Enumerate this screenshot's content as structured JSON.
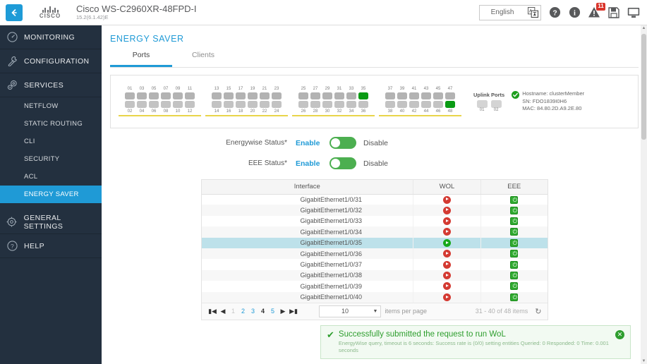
{
  "header": {
    "back_icon": "back-arrow-icon",
    "brand": "CISCO",
    "device_name": "Cisco WS-C2960XR-48FPD-I",
    "device_version": "15.2(6.1.42)E",
    "language": "English",
    "translate_icon": "translate-icon",
    "help_icon": "help-icon",
    "info_icon": "info-icon",
    "alert_icon": "alert-triangle-icon",
    "alert_count": "11",
    "save_icon": "save-icon",
    "console_icon": "monitor-icon"
  },
  "sidebar": {
    "items": [
      {
        "label": "MONITORING",
        "icon": "gauge-icon"
      },
      {
        "label": "CONFIGURATION",
        "icon": "wrench-icon"
      },
      {
        "label": "SERVICES",
        "icon": "services-icon"
      }
    ],
    "sub_items": [
      {
        "label": "NETFLOW",
        "active": false
      },
      {
        "label": "STATIC ROUTING",
        "active": false
      },
      {
        "label": "CLI",
        "active": false
      },
      {
        "label": "SECURITY",
        "active": false
      },
      {
        "label": "ACL",
        "active": false
      },
      {
        "label": "ENERGY SAVER",
        "active": true
      }
    ],
    "footer_items": [
      {
        "label": "GENERAL SETTINGS",
        "icon": "gear-icon"
      },
      {
        "label": "HELP",
        "icon": "question-circle-icon"
      }
    ]
  },
  "main": {
    "page_title": "ENERGY SAVER",
    "tabs": [
      {
        "label": "Ports",
        "active": true
      },
      {
        "label": "Clients",
        "active": false
      }
    ]
  },
  "ports": {
    "groups": [
      {
        "top": [
          "01",
          "03",
          "05",
          "07",
          "09",
          "11"
        ],
        "bottom": [
          "02",
          "04",
          "06",
          "08",
          "10",
          "12"
        ]
      },
      {
        "top": [
          "13",
          "15",
          "17",
          "19",
          "21",
          "23"
        ],
        "bottom": [
          "14",
          "16",
          "18",
          "20",
          "22",
          "24"
        ]
      },
      {
        "top": [
          "25",
          "27",
          "29",
          "31",
          "33",
          "35"
        ],
        "bottom": [
          "26",
          "28",
          "30",
          "32",
          "34",
          "36"
        ]
      },
      {
        "top": [
          "37",
          "39",
          "41",
          "43",
          "45",
          "47"
        ],
        "bottom": [
          "38",
          "40",
          "42",
          "44",
          "46",
          "48"
        ]
      }
    ],
    "active_ports": [
      "35",
      "48"
    ],
    "uplink_label": "Uplink Ports",
    "uplink_ports": [
      "01",
      "02"
    ],
    "status_icon": "status-ok-icon",
    "hostname": "Hostname: clusterMember",
    "serial": "SN: FDO1839I0H6",
    "mac": "MAC: 84.80.2D.A9.2E.80"
  },
  "settings": {
    "energywise": {
      "label": "Energywise Status",
      "required_mark": "*",
      "enable_label": "Enable",
      "disable_label": "Disable",
      "value": "Enable"
    },
    "eee": {
      "label": "EEE Status",
      "required_mark": "*",
      "enable_label": "Enable",
      "disable_label": "Disable",
      "value": "Enable"
    }
  },
  "table": {
    "columns": [
      "Interface",
      "WOL",
      "EEE"
    ],
    "rows": [
      {
        "interface": "GigabitEthernet1/0/31",
        "wol": "stopped",
        "eee": "on",
        "selected": false
      },
      {
        "interface": "GigabitEthernet1/0/32",
        "wol": "stopped",
        "eee": "on",
        "selected": false
      },
      {
        "interface": "GigabitEthernet1/0/33",
        "wol": "stopped",
        "eee": "on",
        "selected": false
      },
      {
        "interface": "GigabitEthernet1/0/34",
        "wol": "stopped",
        "eee": "on",
        "selected": false
      },
      {
        "interface": "GigabitEthernet1/0/35",
        "wol": "running",
        "eee": "on",
        "selected": true
      },
      {
        "interface": "GigabitEthernet1/0/36",
        "wol": "stopped",
        "eee": "on",
        "selected": false
      },
      {
        "interface": "GigabitEthernet1/0/37",
        "wol": "stopped",
        "eee": "on",
        "selected": false
      },
      {
        "interface": "GigabitEthernet1/0/38",
        "wol": "stopped",
        "eee": "on",
        "selected": false
      },
      {
        "interface": "GigabitEthernet1/0/39",
        "wol": "stopped",
        "eee": "on",
        "selected": false
      },
      {
        "interface": "GigabitEthernet1/0/40",
        "wol": "stopped",
        "eee": "on",
        "selected": false
      }
    ]
  },
  "pager": {
    "first_icon": "first-page-icon",
    "prev_icon": "prev-page-icon",
    "pages": [
      {
        "label": "1",
        "state": "disabled"
      },
      {
        "label": "2",
        "state": "link"
      },
      {
        "label": "3",
        "state": "link"
      },
      {
        "label": "4",
        "state": "current"
      },
      {
        "label": "5",
        "state": "link"
      }
    ],
    "next_icon": "next-page-icon",
    "last_icon": "last-page-icon",
    "items_per_page": "10",
    "items_per_page_label": "items per page",
    "range": "31 - 40 of 48 items",
    "refresh_icon": "refresh-icon"
  },
  "toast": {
    "check_icon": "check-icon",
    "title": "Successfully submitted the request to run WoL",
    "detail": "EnergyWise query, timeout is 6 seconds: Success rate is (0/0) setting entities Queried: 0 Responded: 0 Time: 0.001 seconds",
    "close_icon": "close-icon"
  },
  "colors": {
    "accent": "#1f9ad6",
    "sidebar_bg": "#23303f",
    "port_active": "#0a9b14",
    "toggle_on": "#4caf50",
    "alert": "#d9342b",
    "success": "#2e9e2e"
  }
}
